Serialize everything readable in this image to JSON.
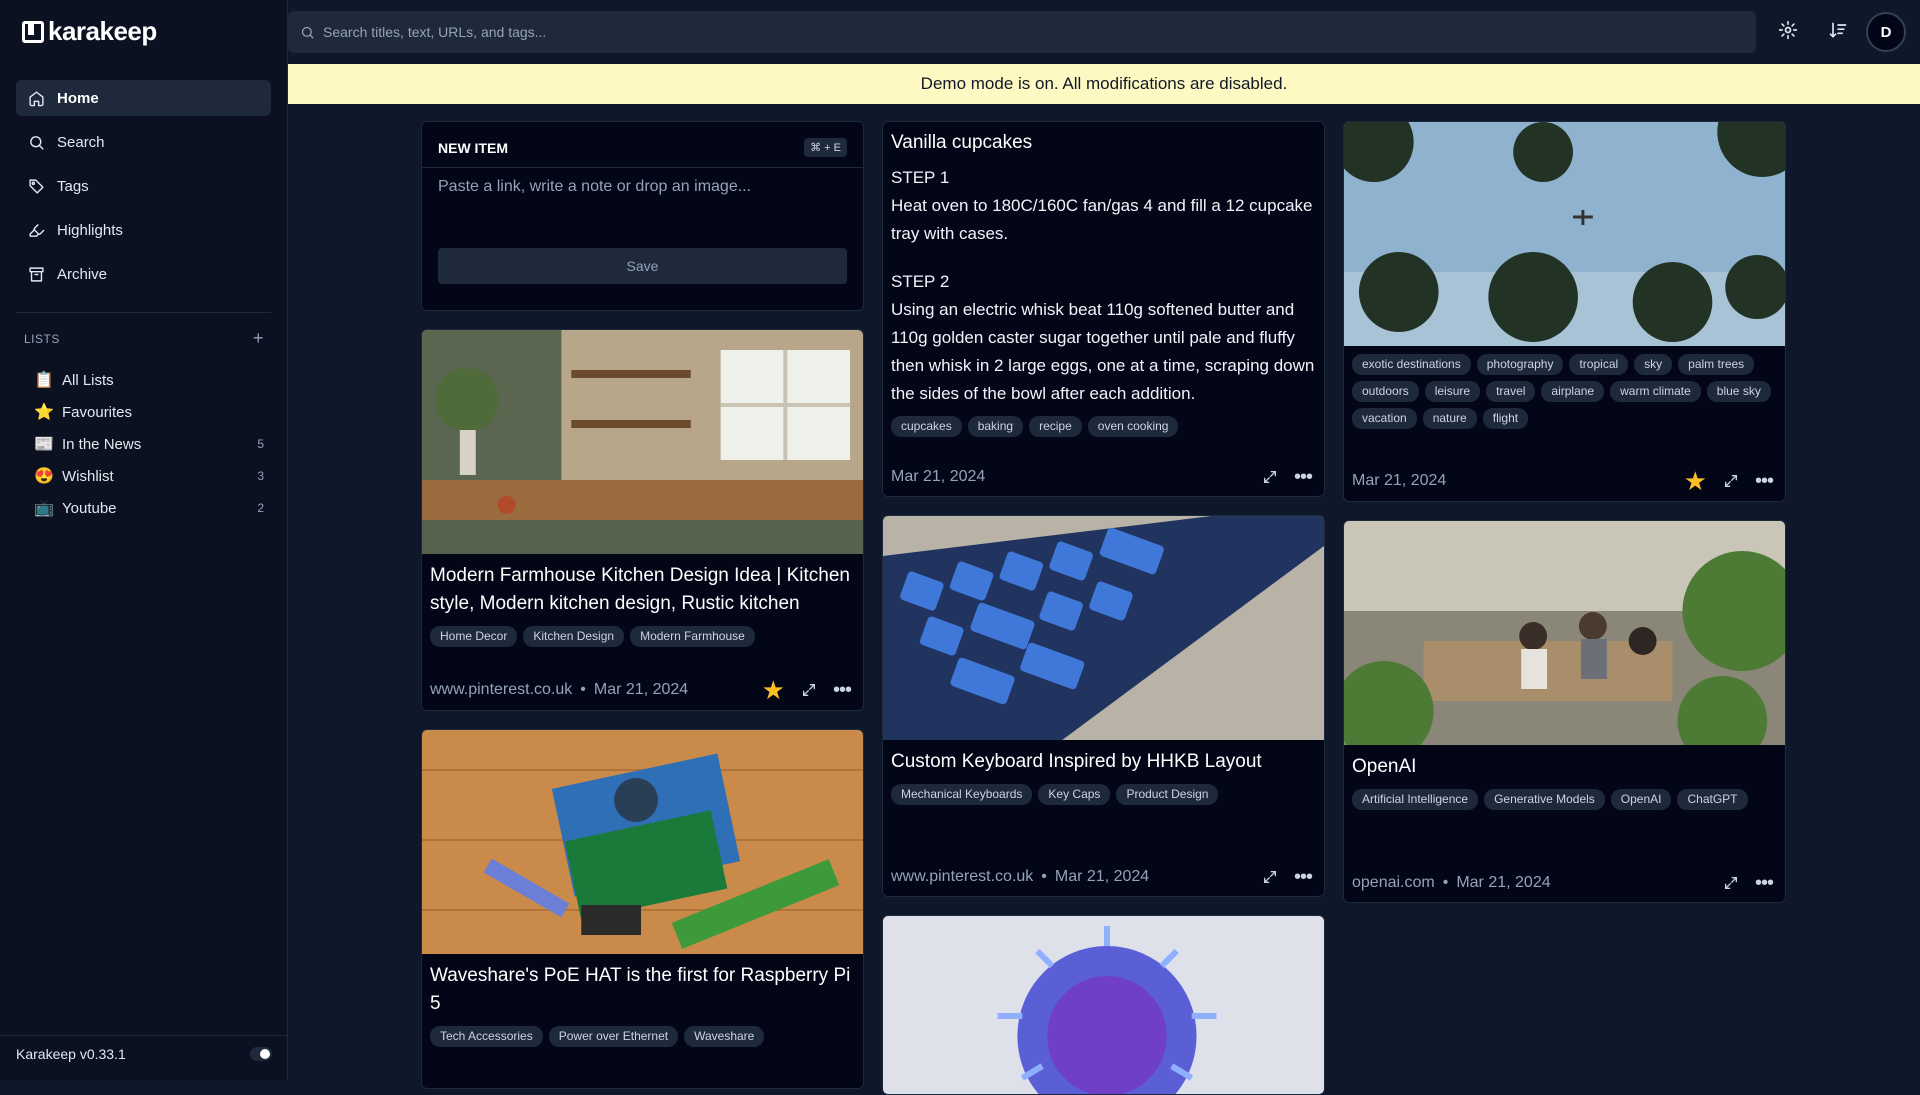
{
  "app": {
    "name": "karakeep",
    "version": "Karakeep v0.33.1"
  },
  "nav": [
    {
      "label": "Home"
    },
    {
      "label": "Search"
    },
    {
      "label": "Tags"
    },
    {
      "label": "Highlights"
    },
    {
      "label": "Archive"
    }
  ],
  "lists": {
    "header": "LISTS",
    "add_label": "+",
    "items": [
      {
        "emoji": "📋",
        "label": "All Lists",
        "count": ""
      },
      {
        "emoji": "⭐",
        "label": "Favourites",
        "count": ""
      },
      {
        "emoji": "📰",
        "label": "In the News",
        "count": "5"
      },
      {
        "emoji": "😍",
        "label": "Wishlist",
        "count": "3"
      },
      {
        "emoji": "📺",
        "label": "Youtube",
        "count": "2"
      }
    ]
  },
  "search": {
    "placeholder": "Search titles, text, URLs, and tags..."
  },
  "user": {
    "initial": "D"
  },
  "banner": "Demo mode is on. All modifications are disabled.",
  "new_item": {
    "title": "NEW ITEM",
    "shortcut": "⌘ + E",
    "placeholder": "Paste a link, write a note or drop an image...",
    "save_label": "Save"
  },
  "cards": {
    "kitchen": {
      "title": "Modern Farmhouse Kitchen Design Idea | Kitchen style, Modern kitchen design, Rustic kitchen",
      "tags": [
        "Home Decor",
        "Kitchen Design",
        "Modern Farmhouse"
      ],
      "source": "www.pinterest.co.uk",
      "date": "Mar 21, 2024",
      "favourite": true
    },
    "waveshare": {
      "title": "Waveshare's PoE HAT is the first for Raspberry Pi 5",
      "tags": [
        "Tech Accessories",
        "Power over Ethernet",
        "Waveshare"
      ]
    },
    "cupcakes": {
      "title": "Vanilla cupcakes",
      "step1_head": "STEP 1",
      "step1": "Heat oven to 180C/160C fan/gas 4 and fill a 12 cupcake tray with cases.",
      "step2_head": "STEP 2",
      "step2": "Using an electric whisk beat 110g softened butter and 110g golden caster sugar together until pale and fluffy then whisk in 2 large eggs, one at a time, scraping down the sides of the bowl after each addition.",
      "tags": [
        "cupcakes",
        "baking",
        "recipe",
        "oven cooking"
      ],
      "date": "Mar 21, 2024"
    },
    "keyboard": {
      "title": "Custom Keyboard Inspired by HHKB Layout",
      "tags": [
        "Mechanical Keyboards",
        "Key Caps",
        "Product Design"
      ],
      "source": "www.pinterest.co.uk",
      "date": "Mar 21, 2024"
    },
    "palms": {
      "tags": [
        "exotic destinations",
        "photography",
        "tropical",
        "sky",
        "palm trees",
        "outdoors",
        "leisure",
        "travel",
        "airplane",
        "warm climate",
        "blue sky",
        "vacation",
        "nature",
        "flight"
      ],
      "date": "Mar 21, 2024",
      "favourite": true
    },
    "openai": {
      "title": "OpenAI",
      "tags": [
        "Artificial Intelligence",
        "Generative Models",
        "OpenAI",
        "ChatGPT"
      ],
      "source": "openai.com",
      "date": "Mar 21, 2024"
    }
  },
  "colors": {
    "accent_star": "#fbbf24",
    "banner_bg": "#fef9c3",
    "background": "#0f172a"
  }
}
